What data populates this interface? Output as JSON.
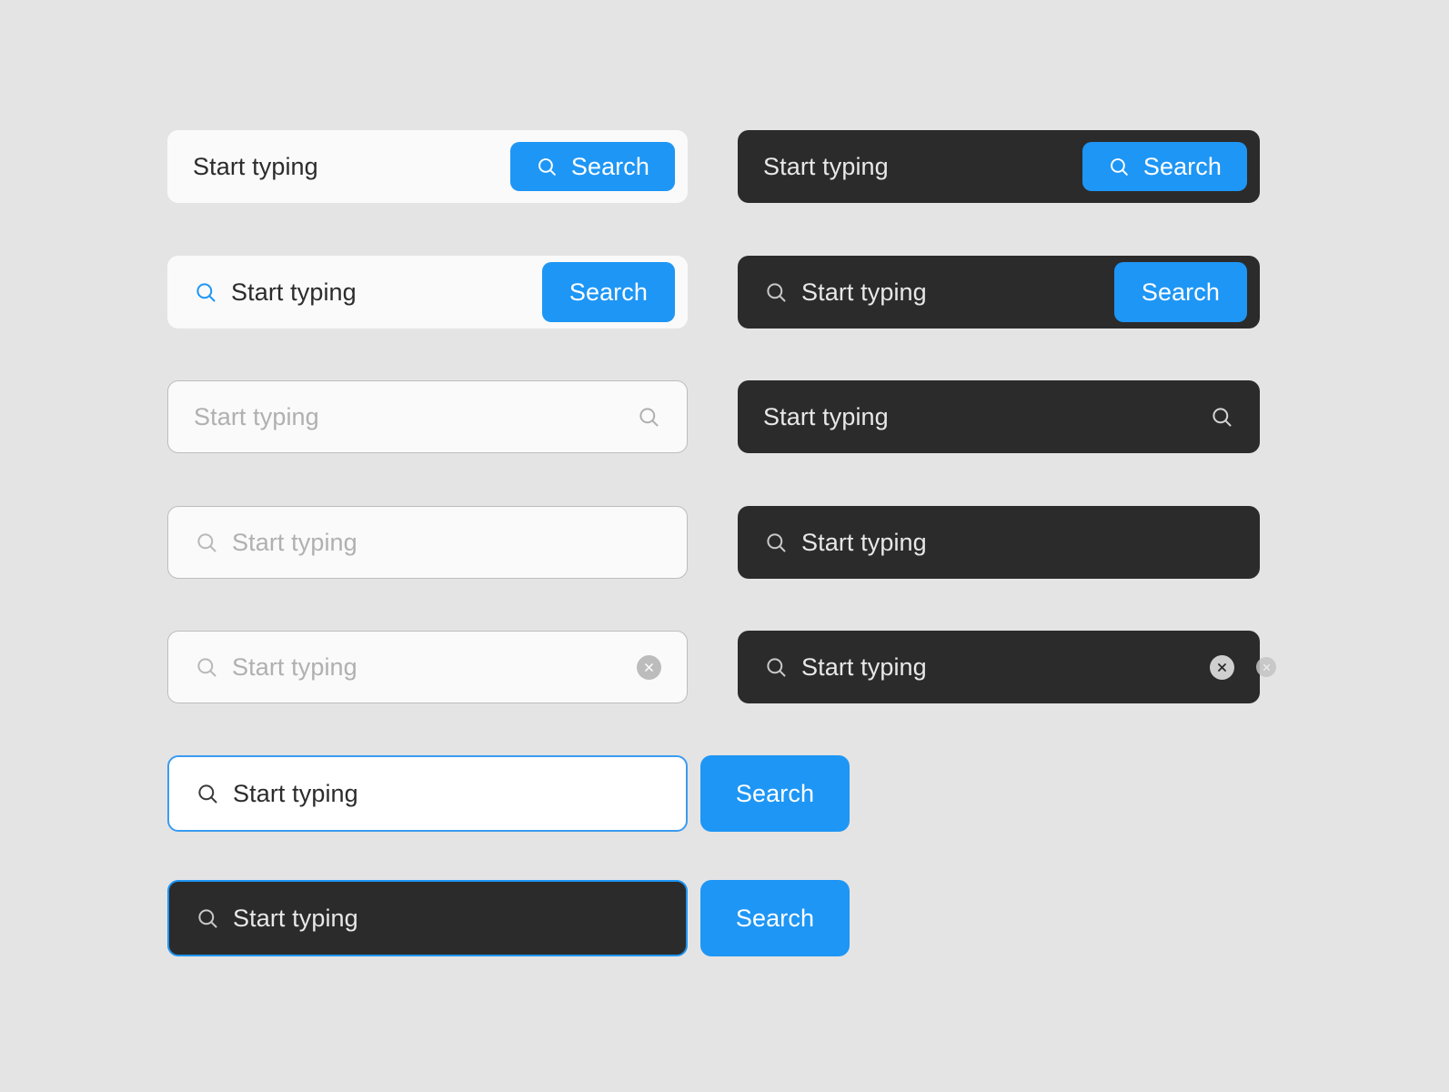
{
  "theme": {
    "page_background": "#e4e4e4",
    "surface_light": "#fafafa",
    "surface_dark": "#2b2b2b",
    "accent_blue": "#1e96f5",
    "focus_border": "#3b9bf0",
    "border_grey": "#bdbdbd",
    "text_dark": "#2b2b2b",
    "text_on_dark": "#e8e8e8",
    "placeholder_light": "#b0b0b0",
    "placeholder_on_dark": "#c9c9c9",
    "clear_circle": "#bcbcbc"
  },
  "labels": {
    "value": "Start typing",
    "placeholder": "Start typing",
    "search": "Search"
  },
  "icons": {
    "search": "search-icon",
    "clear": "clear-icon"
  },
  "rows": [
    {
      "id": "row-1",
      "light": {
        "name": "searchbar-filled-light-button-inline",
        "text": "Start typing",
        "button": "Search"
      },
      "dark": {
        "name": "searchbar-filled-dark-button-inline",
        "text": "Start typing",
        "button": "Search"
      }
    },
    {
      "id": "row-2",
      "light": {
        "name": "searchbar-leading-icon-light-button-edge",
        "text": "Start typing",
        "button": "Search"
      },
      "dark": {
        "name": "searchbar-leading-icon-dark-button-edge",
        "text": "Start typing",
        "button": "Search"
      }
    },
    {
      "id": "row-3",
      "light": {
        "name": "searchbar-outlined-light-trailing-icon",
        "text": "Start typing"
      },
      "dark": {
        "name": "searchbar-dark-trailing-icon",
        "text": "Start typing"
      }
    },
    {
      "id": "row-4",
      "light": {
        "name": "searchbar-outlined-light-leading-icon",
        "text": "Start typing"
      },
      "dark": {
        "name": "searchbar-dark-leading-icon",
        "text": "Start typing"
      }
    },
    {
      "id": "row-5",
      "light": {
        "name": "searchbar-outlined-light-clearable",
        "text": "Start typing"
      },
      "dark": {
        "name": "searchbar-dark-clearable",
        "text": "Start typing"
      }
    },
    {
      "id": "row-6",
      "light": {
        "name": "searchbar-focused-light",
        "text": "Start typing",
        "button": "Search"
      }
    },
    {
      "id": "row-7",
      "dark": {
        "name": "searchbar-focused-dark",
        "text": "Start typing",
        "button": "Search"
      }
    }
  ]
}
